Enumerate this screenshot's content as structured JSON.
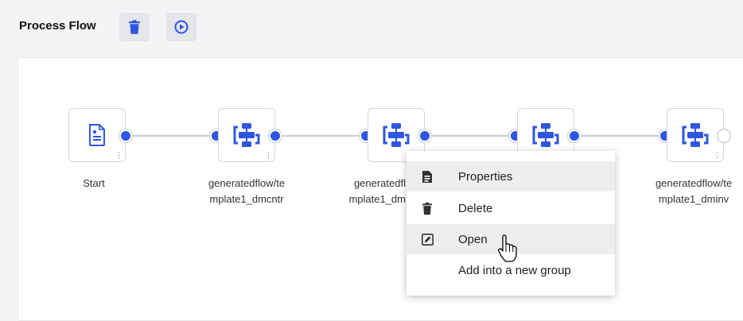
{
  "header": {
    "title": "Process Flow"
  },
  "toolbar": {
    "delete_icon": "trash-icon",
    "run_icon": "play-circle-icon"
  },
  "nodes": [
    {
      "type": "start",
      "icon": "document-icon",
      "label_line1": "Start",
      "label_line2": ""
    },
    {
      "type": "flow",
      "icon": "flow-icon",
      "label_line1": "generatedflow/te",
      "label_line2": "mplate1_dmcntr"
    },
    {
      "type": "flow",
      "icon": "flow-icon",
      "label_line1": "generatedfl",
      "label_line2": "mplate1_dm"
    },
    {
      "type": "flow",
      "icon": "flow-icon",
      "label_line1": "",
      "label_line2": ""
    },
    {
      "type": "flow",
      "icon": "flow-icon",
      "label_line1": "generatedflow/te",
      "label_line2": "mplate1_dminv"
    }
  ],
  "context_menu": {
    "items": [
      {
        "label": "Properties",
        "icon": "properties-icon"
      },
      {
        "label": "Delete",
        "icon": "trash-icon"
      },
      {
        "label": "Open",
        "icon": "edit-icon"
      },
      {
        "label": "Add into a new group",
        "icon": ""
      }
    ]
  },
  "colors": {
    "accent": "#2f56e0",
    "icon_blue": "#3a57d6",
    "text": "#333333"
  }
}
